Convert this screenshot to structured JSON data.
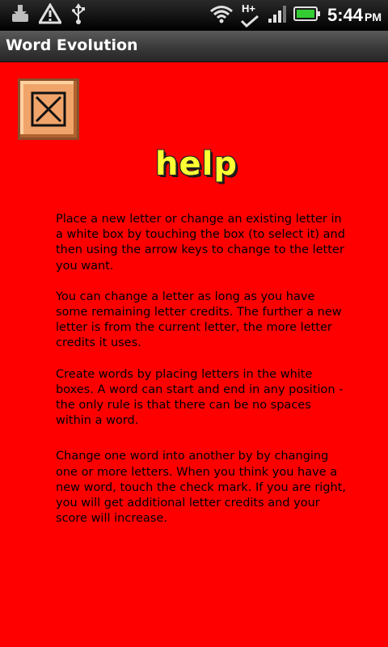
{
  "status_bar": {
    "time": "5:44",
    "ampm": "PM",
    "network": "H+",
    "icons": [
      "download-icon",
      "warning-icon",
      "usb-icon",
      "wifi-icon",
      "hplus-icon",
      "signal-icon",
      "battery-icon"
    ]
  },
  "app": {
    "title": "Word Evolution"
  },
  "close_button": {
    "icon": "close-x-icon"
  },
  "help": {
    "title": "help",
    "paragraphs": [
      "Place a new letter or change an existing letter in a white box by touching the box (to select it) and then using the arrow keys to change to the letter you want.",
      "You can change a letter as long as you have some remaining letter credits. The further a new letter is from the current letter, the more letter credits it uses.",
      "Create words by placing letters in the white boxes. A word can start and end in any position - the only rule is that there can be no spaces within a word.",
      "Change one word into another by by changing one or more letters. When you think you have a new word, touch the check mark. If you are right, you will get additional letter credits and your score will increase."
    ]
  },
  "colors": {
    "background": "#ff0000",
    "help_title": "#ffff33",
    "button_face": "#f0a46a",
    "battery": "#33cc33"
  }
}
